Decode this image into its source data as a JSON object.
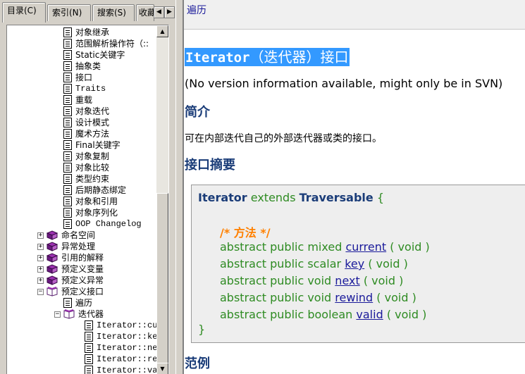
{
  "tabs": [
    {
      "label": "目录(C)",
      "active": true
    },
    {
      "label": "索引(N)",
      "active": false
    },
    {
      "label": "搜索(S)",
      "active": false
    },
    {
      "label": "收藏",
      "active": false
    }
  ],
  "tab_scroll": {
    "left": "◀",
    "right": "▶"
  },
  "tree": {
    "items": [
      {
        "label": "对象继承",
        "type": "page",
        "depth": 2
      },
      {
        "label": "范围解析操作符（::",
        "type": "page",
        "depth": 2
      },
      {
        "label": "Static关键字",
        "type": "page",
        "depth": 2
      },
      {
        "label": "抽象类",
        "type": "page",
        "depth": 2
      },
      {
        "label": "接口",
        "type": "page",
        "depth": 2
      },
      {
        "label": "Traits",
        "type": "page",
        "depth": 2
      },
      {
        "label": "重载",
        "type": "page",
        "depth": 2
      },
      {
        "label": "对象迭代",
        "type": "page",
        "depth": 2
      },
      {
        "label": "设计模式",
        "type": "page",
        "depth": 2
      },
      {
        "label": "魔术方法",
        "type": "page",
        "depth": 2
      },
      {
        "label": "Final关键字",
        "type": "page",
        "depth": 2
      },
      {
        "label": "对象复制",
        "type": "page",
        "depth": 2
      },
      {
        "label": "对象比较",
        "type": "page",
        "depth": 2
      },
      {
        "label": "类型约束",
        "type": "page",
        "depth": 2
      },
      {
        "label": "后期静态绑定",
        "type": "page",
        "depth": 2
      },
      {
        "label": "对象和引用",
        "type": "page",
        "depth": 2
      },
      {
        "label": "对象序列化",
        "type": "page",
        "depth": 2
      },
      {
        "label": "OOP Changelog",
        "type": "page",
        "depth": 2
      },
      {
        "label": "命名空间",
        "type": "book",
        "depth": 1,
        "expander": "+"
      },
      {
        "label": "异常处理",
        "type": "book",
        "depth": 1,
        "expander": "+"
      },
      {
        "label": "引用的解释",
        "type": "book",
        "depth": 1,
        "expander": "+"
      },
      {
        "label": "预定义变量",
        "type": "book",
        "depth": 1,
        "expander": "+"
      },
      {
        "label": "预定义异常",
        "type": "book",
        "depth": 1,
        "expander": "+"
      },
      {
        "label": "预定义接口",
        "type": "book-open",
        "depth": 1,
        "expander": "−"
      },
      {
        "label": "遍历",
        "type": "page",
        "depth": 2
      },
      {
        "label": "迭代器",
        "type": "book-open",
        "depth": 2,
        "expander": "−"
      },
      {
        "label": "Iterator::cur",
        "type": "page",
        "depth": 3
      },
      {
        "label": "Iterator::key",
        "type": "page",
        "depth": 3
      },
      {
        "label": "Iterator::nex",
        "type": "page",
        "depth": 3
      },
      {
        "label": "Iterator::rew",
        "type": "page",
        "depth": 3
      },
      {
        "label": "Iterator::val",
        "type": "page",
        "depth": 3
      }
    ]
  },
  "scrollbar": {
    "up": "▲",
    "down": "▼"
  },
  "content": {
    "nav_link": "遍历",
    "title_code": "Iterator",
    "title_rest": "（迭代器）接口",
    "version": "(No version information available, might only be in SVN)",
    "h_intro": "简介",
    "intro_text": "可在内部迭代自己的外部迭代器或类的接口。",
    "h_synopsis": "接口摘要",
    "synopsis": {
      "class": "Iterator",
      "extends": "extends",
      "parent": "Traversable",
      "open_brace": "{",
      "comment": "/* 方法 */",
      "methods": [
        {
          "prefix": "abstract public mixed",
          "name": "current",
          "args": "( void )"
        },
        {
          "prefix": "abstract public scalar",
          "name": "key",
          "args": "( void )"
        },
        {
          "prefix": "abstract public void",
          "name": "next",
          "args": "( void )"
        },
        {
          "prefix": "abstract public void",
          "name": "rewind",
          "args": "( void )"
        },
        {
          "prefix": "abstract public boolean",
          "name": "valid",
          "args": "( void )"
        }
      ],
      "close_brace": "}"
    },
    "h_examples": "范例"
  },
  "colors": {
    "selection": "#3399ff",
    "heading": "#1a3c78",
    "keyword": "#2e8b22",
    "comment": "#ff8000",
    "link": "#1a1a9a"
  }
}
